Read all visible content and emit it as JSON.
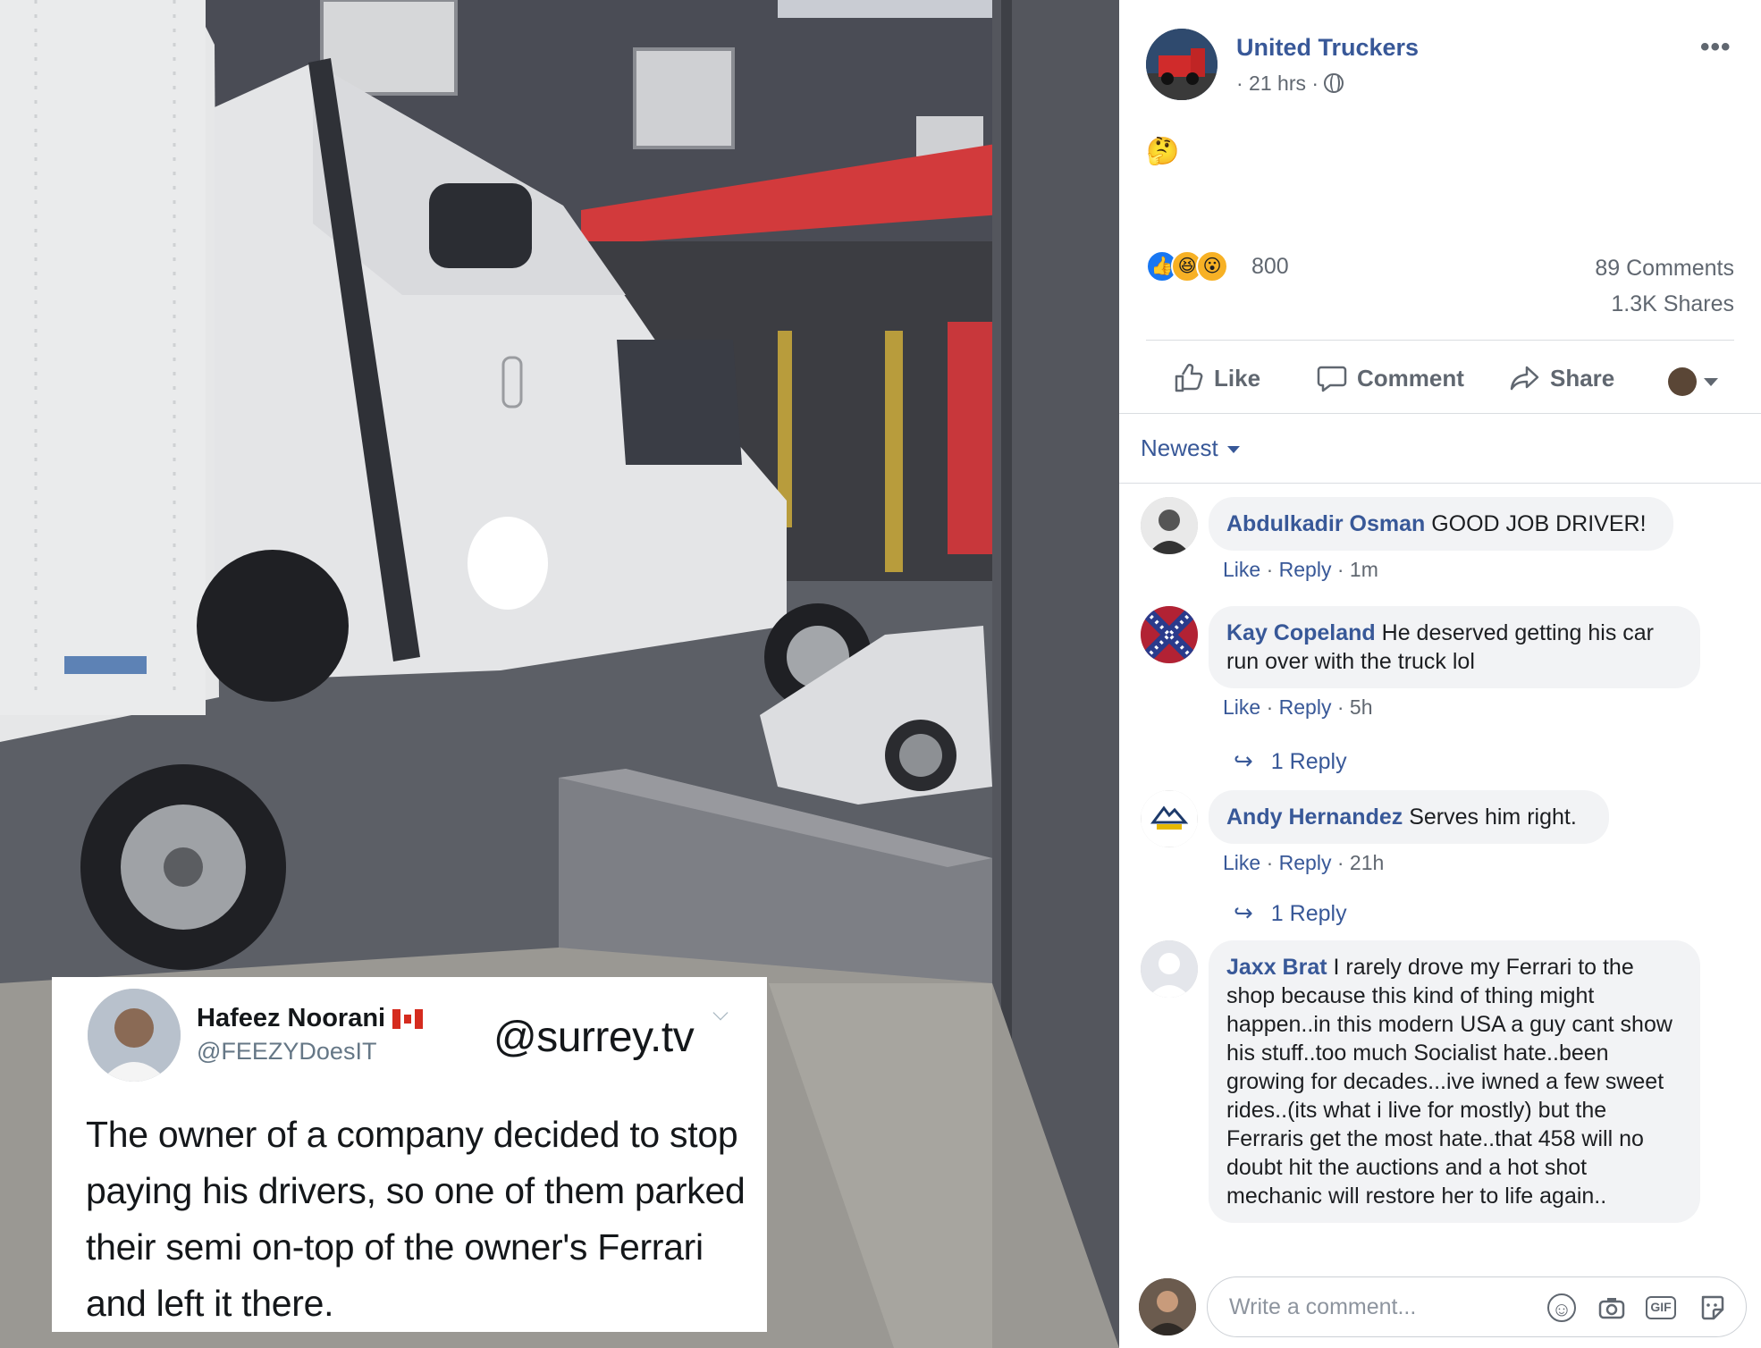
{
  "post": {
    "page_name": "United Truckers",
    "time": "· 21 hrs ·",
    "emoji": "🤔",
    "reactions_count": "800",
    "comments_count": "89 Comments",
    "shares_count": "1.3K Shares",
    "actions": {
      "like": "Like",
      "comment": "Comment",
      "share": "Share"
    }
  },
  "image": {
    "tweet": {
      "name": "Hafeez Noorani",
      "handle": "@FEEZYDoesIT",
      "source": "@surrey.tv",
      "text": "The owner of a company decided to stop paying his drivers, so one of them parked their semi on-top of the owner's Ferrari and left it there."
    }
  },
  "sort": {
    "label": "Newest"
  },
  "comments": [
    {
      "author": "Abdulkadir Osman",
      "text": "GOOD JOB DRIVER!",
      "like": "Like",
      "reply": "Reply",
      "time": "1m"
    },
    {
      "author": "Kay Copeland",
      "text": "He deserved getting his car run over with the truck lol",
      "like": "Like",
      "reply": "Reply",
      "time": "5h",
      "replies": "1 Reply"
    },
    {
      "author": "Andy Hernandez",
      "text": "Serves him right.",
      "like": "Like",
      "reply": "Reply",
      "time": "21h",
      "replies": "1 Reply"
    },
    {
      "author": "Jaxx Brat",
      "text": "I rarely drove my Ferrari to the shop because this kind of thing might happen..in this modern USA a guy cant show his stuff..too much Socialist hate..been growing for decades...ive iwned a few sweet rides..(its what i live for mostly) but the Ferraris get the most hate..that 458 will no doubt hit the auctions and a hot shot mechanic will restore her to life again.."
    }
  ],
  "composer": {
    "placeholder": "Write a comment..."
  },
  "colors": {
    "link": "#385898",
    "like_blue": "#1877f2",
    "bubble": "#f2f3f5",
    "muted": "#606770"
  }
}
